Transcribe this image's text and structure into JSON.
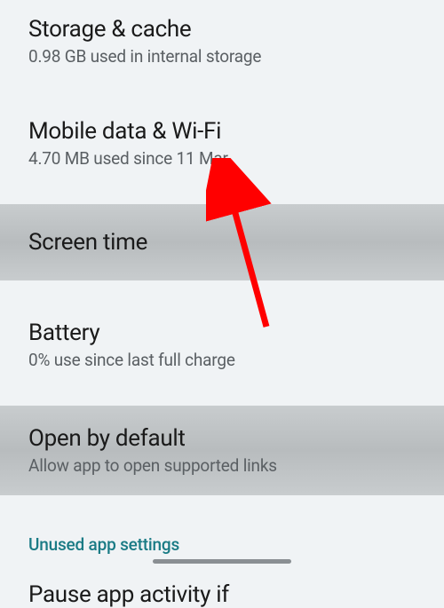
{
  "settings": {
    "storage": {
      "title": "Storage & cache",
      "subtitle": "0.98 GB used in internal storage"
    },
    "mobileData": {
      "title": "Mobile data & Wi-Fi",
      "subtitle": "4.70 MB used since 11 Mar"
    },
    "screenTime": {
      "title": "Screen time"
    },
    "battery": {
      "title": "Battery",
      "subtitle": "0% use since last full charge"
    },
    "openDefault": {
      "title": "Open by default",
      "subtitle": "Allow app to open supported links"
    },
    "unusedApps": {
      "linkText": "Unused app settings"
    },
    "pauseActivity": {
      "title": "Pause app activity if"
    }
  },
  "annotation": {
    "arrowColor": "#ff0000"
  }
}
